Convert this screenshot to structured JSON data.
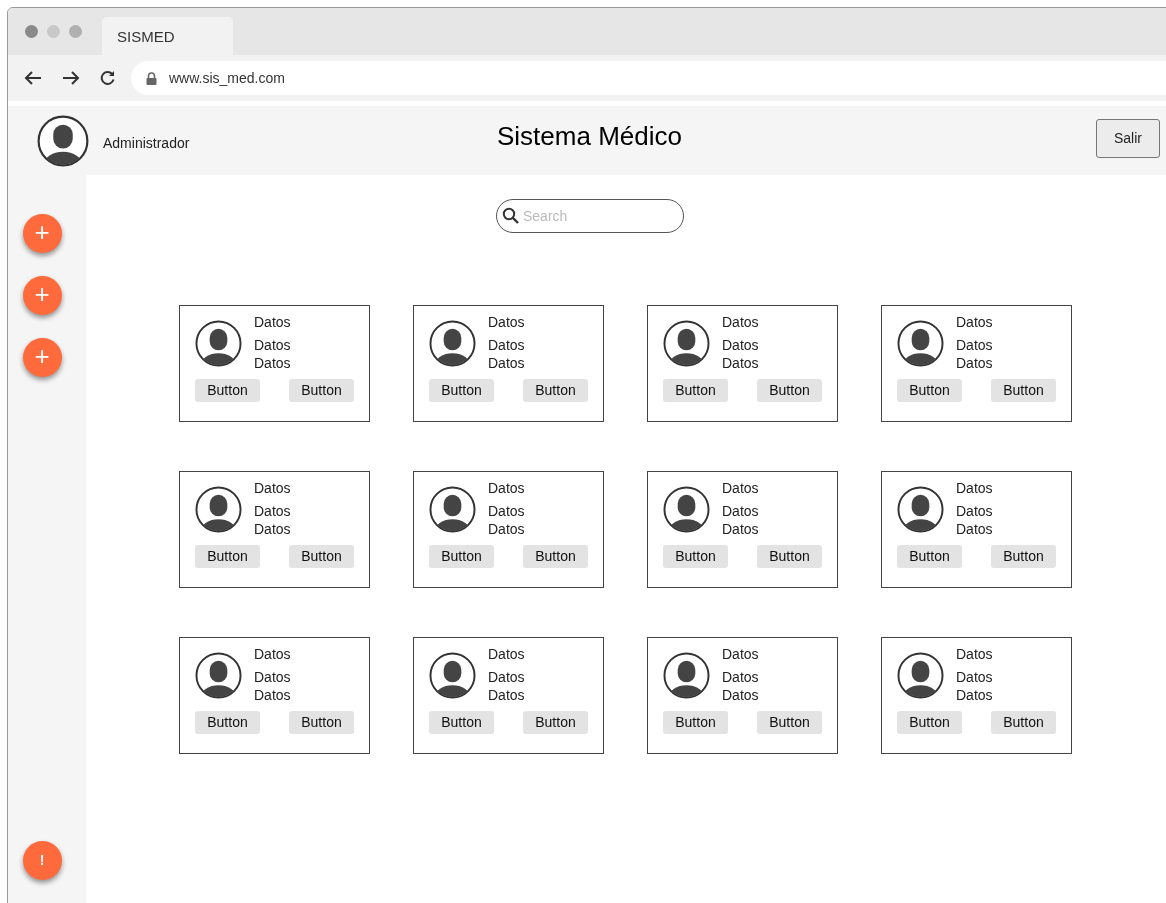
{
  "browser": {
    "tab_title": "SISMED",
    "url": "www.sis_med.com"
  },
  "header": {
    "user": "Administrador",
    "title": "Sistema Médico",
    "logout_button": "Salir"
  },
  "sidebar": {
    "buttons": [
      {
        "label": "+"
      },
      {
        "label": "+"
      },
      {
        "label": "+"
      }
    ],
    "alert_button": "!"
  },
  "search": {
    "placeholder": "Search"
  },
  "cards": [
    {
      "lines": [
        "Datos",
        "Datos",
        "Datos"
      ],
      "buttons": [
        "Button",
        "Button"
      ]
    },
    {
      "lines": [
        "Datos",
        "Datos",
        "Datos"
      ],
      "buttons": [
        "Button",
        "Button"
      ]
    },
    {
      "lines": [
        "Datos",
        "Datos",
        "Datos"
      ],
      "buttons": [
        "Button",
        "Button"
      ]
    },
    {
      "lines": [
        "Datos",
        "Datos",
        "Datos"
      ],
      "buttons": [
        "Button",
        "Button"
      ]
    },
    {
      "lines": [
        "Datos",
        "Datos",
        "Datos"
      ],
      "buttons": [
        "Button",
        "Button"
      ]
    },
    {
      "lines": [
        "Datos",
        "Datos",
        "Datos"
      ],
      "buttons": [
        "Button",
        "Button"
      ]
    },
    {
      "lines": [
        "Datos",
        "Datos",
        "Datos"
      ],
      "buttons": [
        "Button",
        "Button"
      ]
    },
    {
      "lines": [
        "Datos",
        "Datos",
        "Datos"
      ],
      "buttons": [
        "Button",
        "Button"
      ]
    },
    {
      "lines": [
        "Datos",
        "Datos",
        "Datos"
      ],
      "buttons": [
        "Button",
        "Button"
      ]
    },
    {
      "lines": [
        "Datos",
        "Datos",
        "Datos"
      ],
      "buttons": [
        "Button",
        "Button"
      ]
    },
    {
      "lines": [
        "Datos",
        "Datos",
        "Datos"
      ],
      "buttons": [
        "Button",
        "Button"
      ]
    },
    {
      "lines": [
        "Datos",
        "Datos",
        "Datos"
      ],
      "buttons": [
        "Button",
        "Button"
      ]
    }
  ]
}
